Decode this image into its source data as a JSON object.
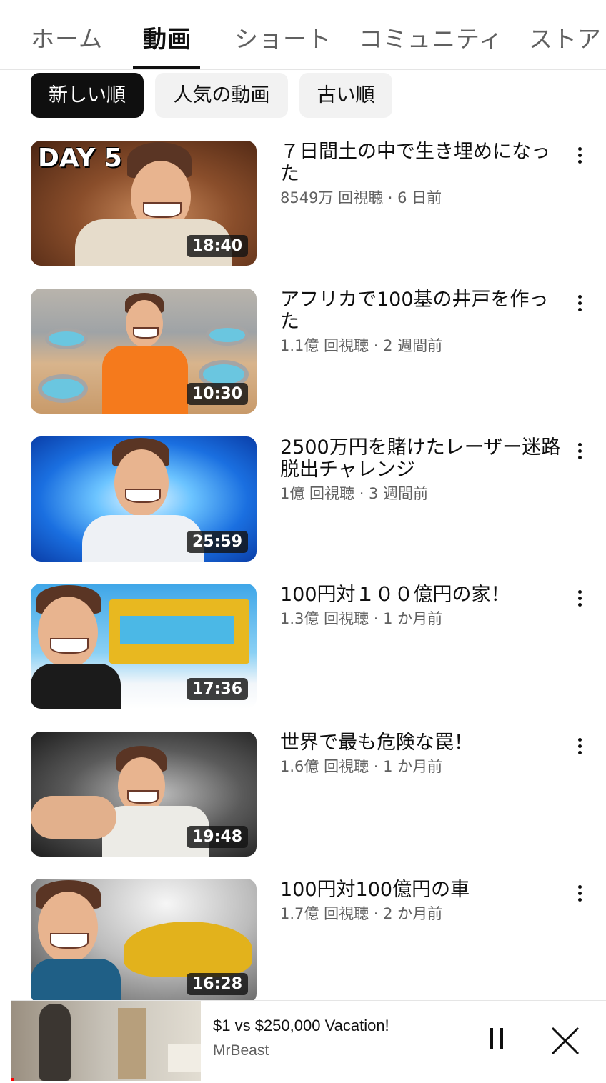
{
  "tabs": [
    {
      "label": "ホーム"
    },
    {
      "label": "動画"
    },
    {
      "label": "ショート"
    },
    {
      "label": "コミュニティ"
    },
    {
      "label": "ストア"
    }
  ],
  "active_tab": "動画",
  "sort_chips": [
    {
      "label": "新しい順",
      "selected": true
    },
    {
      "label": "人気の動画",
      "selected": false
    },
    {
      "label": "古い順",
      "selected": false
    }
  ],
  "videos": [
    {
      "title": "７日間土の中で生き埋めになった",
      "meta": "8549万 回視聴 · 6 日前",
      "duration": "18:40",
      "thumb_text": "DAY 5"
    },
    {
      "title": "アフリカで100基の井戸を作った",
      "meta": "1.1億 回視聴 · 2 週間前",
      "duration": "10:30"
    },
    {
      "title": "2500万円を賭けたレーザー迷路脱出チャレンジ",
      "meta": "1億 回視聴 · 3 週間前",
      "duration": "25:59"
    },
    {
      "title": "100円対１００億円の家！",
      "meta": "1.3億 回視聴 · 1 か月前",
      "duration": "17:36"
    },
    {
      "title": "世界で最も危険な罠！",
      "meta": "1.6億 回視聴 · 1 か月前",
      "duration": "19:48"
    },
    {
      "title": "100円対100億円の車",
      "meta": "1.7億 回視聴 · 2 か月前",
      "duration": "16:28"
    }
  ],
  "miniplayer": {
    "title": "$1 vs $250,000 Vacation!",
    "channel": "MrBeast",
    "progress": 0.02
  },
  "colors": {
    "accent": "#ff0000",
    "text_primary": "#0f0f0f",
    "text_secondary": "#606060",
    "chip_bg": "#f2f2f2",
    "chip_selected_bg": "#0f0f0f"
  }
}
